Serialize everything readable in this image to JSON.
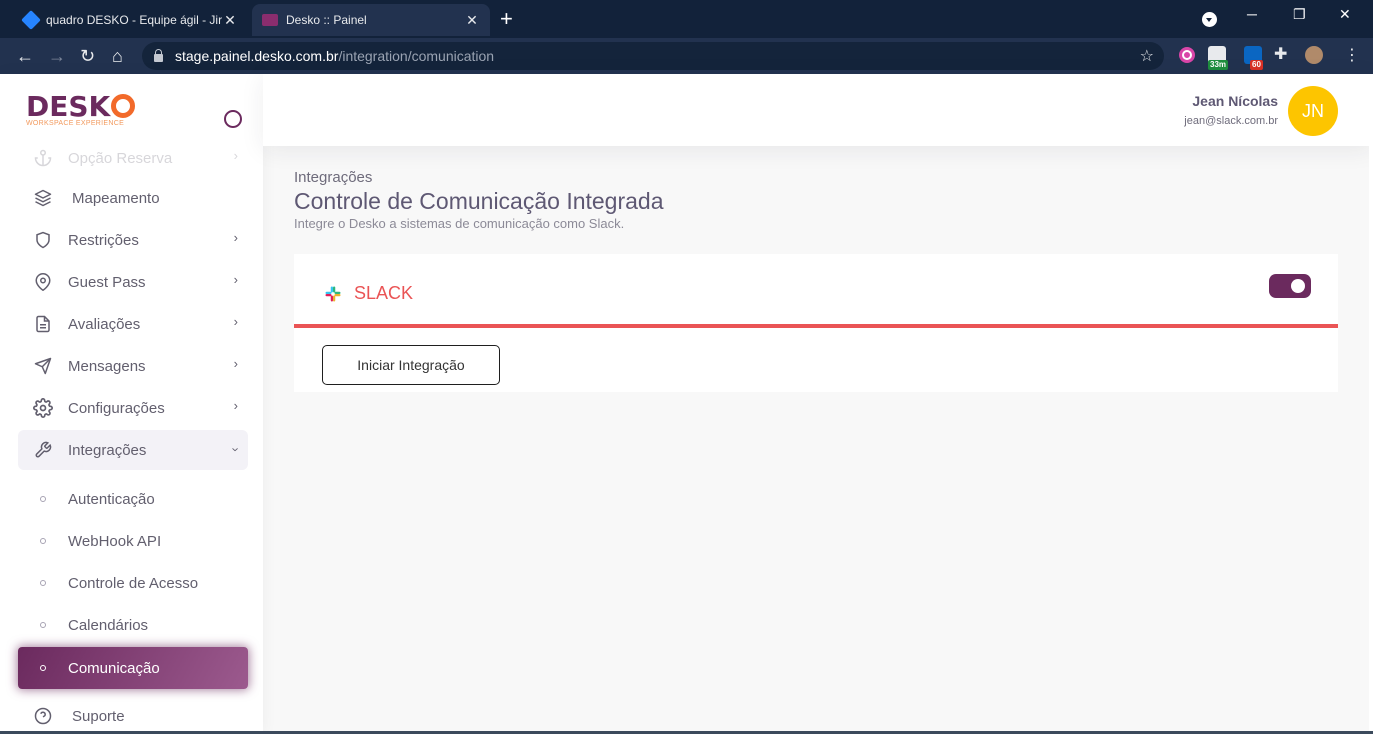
{
  "browser": {
    "tabs": [
      {
        "title": "quadro DESKO - Equipe ágil - Jira",
        "close": "✕"
      },
      {
        "title": "Desko :: Painel",
        "close": "✕"
      }
    ],
    "new_tab": "+",
    "window_controls": {
      "minimize": "─",
      "restore": "❐",
      "close": "✕"
    },
    "url_host": "stage.painel.desko.com.br",
    "url_path": "/integration/comunication",
    "extensions": [
      {
        "icon": "circle-power-extension-icon",
        "badge": ""
      },
      {
        "icon": "calendar-extension-icon",
        "badge": "33m"
      },
      {
        "icon": "linkedin-extension-icon",
        "badge": "60"
      },
      {
        "icon": "puzzle-extensions-icon",
        "badge": ""
      }
    ]
  },
  "sidebar": {
    "logo": {
      "text": "DESK",
      "subtitle": "WORKSPACE EXPERIENCE"
    },
    "items": [
      {
        "label": "Opção Reserva",
        "icon": "anchor-icon"
      },
      {
        "label": "Mapeamento",
        "icon": "layers-icon"
      },
      {
        "label": "Restrições",
        "icon": "shield-icon"
      },
      {
        "label": "Guest Pass",
        "icon": "map-pin-icon"
      },
      {
        "label": "Avaliações",
        "icon": "file-text-icon"
      },
      {
        "label": "Mensagens",
        "icon": "send-icon"
      },
      {
        "label": "Configurações",
        "icon": "settings-icon"
      },
      {
        "label": "Integrações",
        "icon": "tool-icon"
      }
    ],
    "sub_items": [
      {
        "label": "Autenticação"
      },
      {
        "label": "WebHook API"
      },
      {
        "label": "Controle de Acesso"
      },
      {
        "label": "Calendários"
      },
      {
        "label": "Comunicação"
      }
    ],
    "support": {
      "label": "Suporte",
      "icon": "help-circle-icon"
    }
  },
  "header": {
    "user_name": "Jean Nícolas",
    "user_email": "jean@slack.com.br",
    "avatar_initials": "JN",
    "avatar_color": "#fdc500"
  },
  "main": {
    "breadcrumb": "Integrações",
    "title": "Controle de Comunicação Integrada",
    "subtitle": "Integre o Desko a sistemas de comunicação como Slack.",
    "card": {
      "title": "SLACK",
      "toggle_on": true,
      "button_label": "Iniciar Integração"
    }
  },
  "colors": {
    "brand": "#6b2a5e",
    "accent_orange": "#f26a2a",
    "danger": "#ea5455"
  }
}
